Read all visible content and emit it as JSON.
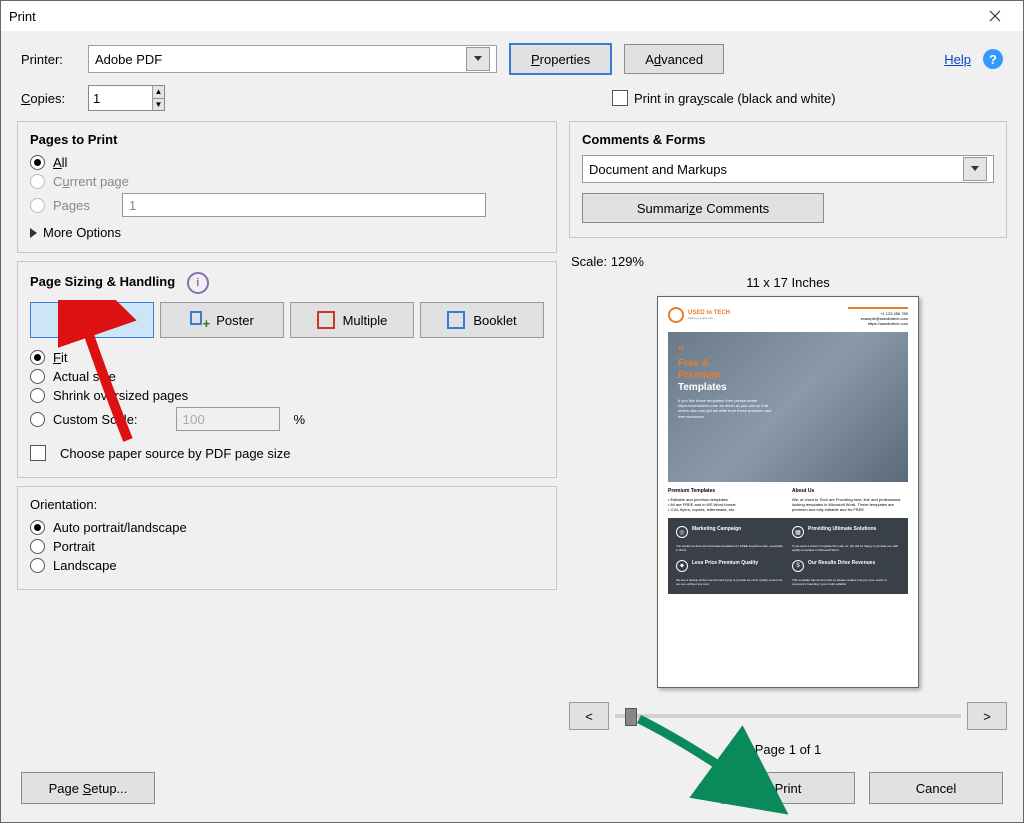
{
  "window": {
    "title": "Print"
  },
  "printer": {
    "label": "Printer:",
    "value": "Adobe PDF",
    "properties_btn": "Properties",
    "advanced_btn": "Advanced"
  },
  "help": {
    "link": "Help"
  },
  "copies": {
    "label": "Copies:",
    "value": "1"
  },
  "grayscale": {
    "label": "Print in grayscale (black and white)"
  },
  "pagesToPrint": {
    "title": "Pages to Print",
    "all": "All",
    "current": "Current page",
    "pages": "Pages",
    "pages_value": "1",
    "more": "More Options"
  },
  "sizing": {
    "title": "Page Sizing & Handling",
    "size": "Size",
    "poster": "Poster",
    "multiple": "Multiple",
    "booklet": "Booklet",
    "fit": "Fit",
    "actual": "Actual size",
    "shrink": "Shrink oversized pages",
    "custom": "Custom Scale:",
    "custom_value": "100",
    "percent": "%",
    "choose_paper": "Choose paper source by PDF page size"
  },
  "orientation": {
    "title": "Orientation:",
    "auto": "Auto portrait/landscape",
    "portrait": "Portrait",
    "landscape": "Landscape"
  },
  "comments": {
    "title": "Comments & Forms",
    "value": "Document and Markups",
    "summarize": "Summarize Comments"
  },
  "preview": {
    "scale": "Scale: 129%",
    "dimensions": "11 x 17 Inches",
    "page_of": "Page 1 of 1",
    "prev": "<",
    "next": ">",
    "doc_logo": "USED to TECH",
    "hero_line1": "Free &",
    "hero_line2": "Premium",
    "hero_line3": "Templates",
    "mid_left_title": "Premium Templates",
    "mid_right_title": "About Us",
    "dark_1": "Marketing Campaign",
    "dark_2": "Providing Ultimate Solutions",
    "dark_3": "Less Price Premium Quality",
    "dark_4": "Our Results Drive Revenues"
  },
  "bottom": {
    "page_setup": "Page Setup...",
    "print": "Print",
    "cancel": "Cancel"
  }
}
